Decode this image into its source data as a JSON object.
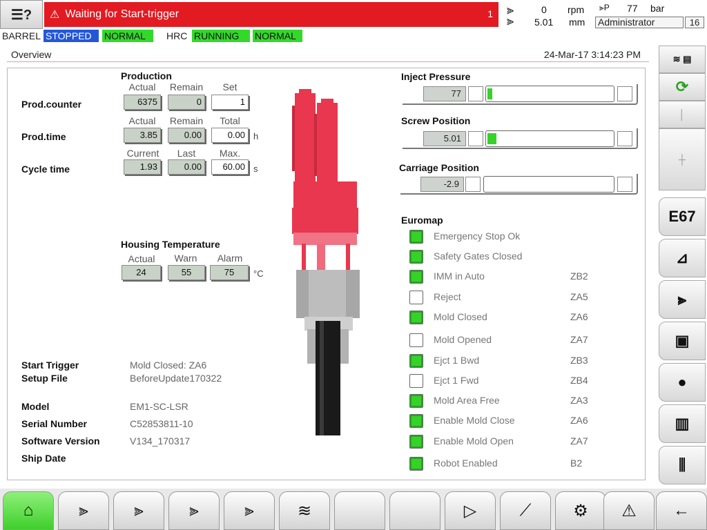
{
  "topbar": {
    "alarm_text": "Waiting for Start-trigger",
    "alarm_count": "1",
    "rpm_value": "0",
    "rpm_unit": "rpm",
    "pos_value": "5.01",
    "pos_unit": "mm",
    "pressure_value": "77",
    "pressure_unit": "bar",
    "user": "Administrator",
    "user_level": "16"
  },
  "status": {
    "barrel": "BARREL",
    "barrel_state": "STOPPED",
    "barrel_mode": "NORMAL",
    "hrc": "HRC",
    "hrc_state": "RUNNING",
    "hrc_mode": "NORMAL"
  },
  "overview": {
    "title": "Overview",
    "datetime": "24-Mar-17 3:14:23 PM"
  },
  "production": {
    "title": "Production",
    "counter_label": "Prod.counter",
    "counter_cols": [
      "Actual",
      "Remain",
      "Set"
    ],
    "counter_vals": [
      "6375",
      "0",
      "1"
    ],
    "time_label": "Prod.time",
    "time_cols": [
      "Actual",
      "Remain",
      "Total"
    ],
    "time_vals": [
      "3.85",
      "0.00",
      "0.00"
    ],
    "time_unit": "h",
    "cycle_label": "Cycle time",
    "cycle_cols": [
      "Current",
      "Last",
      "Max."
    ],
    "cycle_vals": [
      "1.93",
      "0.00",
      "60.00"
    ],
    "cycle_unit": "s"
  },
  "housing": {
    "title": "Housing Temperature",
    "cols": [
      "Actual",
      "Warn",
      "Alarm"
    ],
    "vals": [
      "24",
      "55",
      "75"
    ],
    "unit": "°C"
  },
  "info": {
    "start_trigger_label": "Start Trigger",
    "start_trigger": "Mold Closed: ZA6",
    "setup_file_label": "Setup File",
    "setup_file": "BeforeUpdate170322",
    "model_label": "Model",
    "model": "EM1-SC-LSR",
    "serial_label": "Serial Number",
    "serial": "C52853811-10",
    "software_label": "Software Version",
    "software": "V134_170317",
    "ship_label": "Ship Date",
    "ship": ""
  },
  "gauges": {
    "inject_label": "Inject Pressure",
    "inject_value": "77",
    "inject_fraction": 0.04,
    "screw_label": "Screw Position",
    "screw_value": "5.01",
    "screw_fraction": 0.07,
    "carriage_label": "Carriage Position",
    "carriage_value": "-2.9",
    "carriage_fraction": 0
  },
  "euromap": {
    "title": "Euromap",
    "items": [
      {
        "label": "Emergency Stop Ok",
        "code": "",
        "on": true
      },
      {
        "label": "Safety Gates Closed",
        "code": "",
        "on": true
      },
      {
        "label": "IMM in Auto",
        "code": "ZB2",
        "on": true
      },
      {
        "label": "Reject",
        "code": "ZA5",
        "on": false
      },
      {
        "label": "Mold Closed",
        "code": "ZA6",
        "on": true
      },
      {
        "label": "Mold Opened",
        "code": "ZA7",
        "on": false
      },
      {
        "label": "Ejct 1 Bwd",
        "code": "ZB3",
        "on": true
      },
      {
        "label": "Ejct 1 Fwd",
        "code": "ZB4",
        "on": false
      },
      {
        "label": "Mold Area Free",
        "code": "ZA3",
        "on": true
      },
      {
        "label": "Enable Mold Close",
        "code": "ZA6",
        "on": true
      },
      {
        "label": "Enable Mold Open",
        "code": "ZA7",
        "on": true
      },
      {
        "label": "Robot Enabled",
        "code": "B2",
        "on": true
      }
    ]
  },
  "sidebar": {
    "e67": "E67"
  },
  "colors": {
    "alarm_red": "#e21a22",
    "status_blue": "#2357d8",
    "status_green": "#33d92a",
    "machine_red": "#e8374e"
  }
}
